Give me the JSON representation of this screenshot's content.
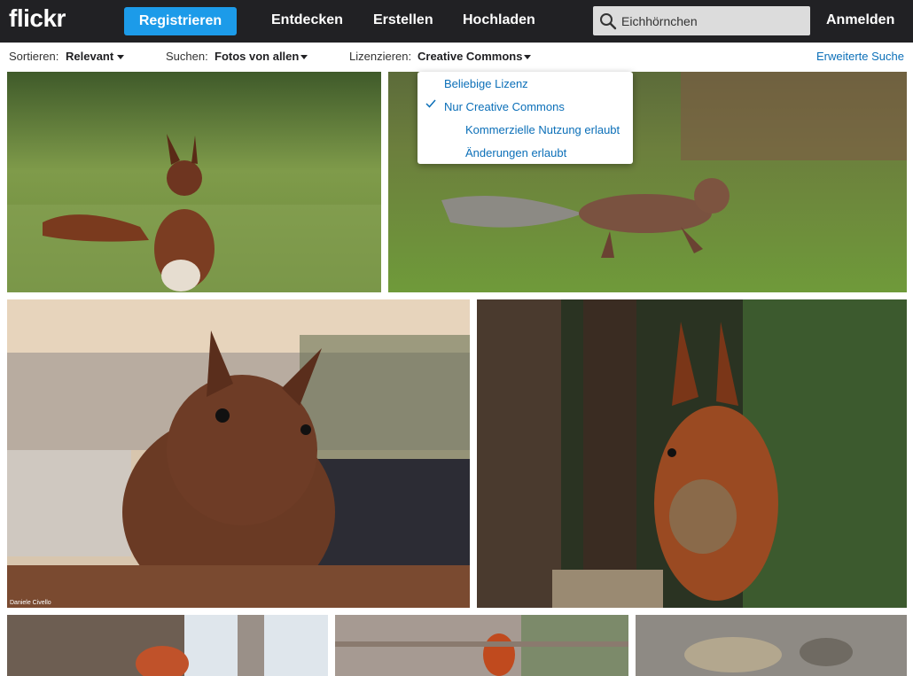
{
  "brand": {
    "logo_text": "flickr"
  },
  "nav": {
    "register_label": "Registrieren",
    "discover_label": "Entdecken",
    "create_label": "Erstellen",
    "upload_label": "Hochladen",
    "signin_label": "Anmelden"
  },
  "search": {
    "value": "Eichhörnchen",
    "icon": "search-icon"
  },
  "filters": {
    "sort_label": "Sortieren:",
    "sort_value": "Relevant",
    "search_label": "Suchen:",
    "search_value": "Fotos von allen",
    "license_label": "Lizenzieren:",
    "license_value": "Creative Commons",
    "advanced_label": "Erweiterte Suche"
  },
  "license_menu": {
    "items": [
      {
        "label": "Beliebige Lizenz",
        "checked": false
      },
      {
        "label": "Nur Creative Commons",
        "checked": true
      },
      {
        "label": "Kommerzielle Nutzung erlaubt",
        "checked": false
      },
      {
        "label": "Änderungen erlaubt",
        "checked": false
      }
    ]
  },
  "photos": {
    "credit_3": "Daniele Civello"
  },
  "colors": {
    "topbar": "#212124",
    "accent": "#1c9be9",
    "link": "#0b6fb8"
  }
}
